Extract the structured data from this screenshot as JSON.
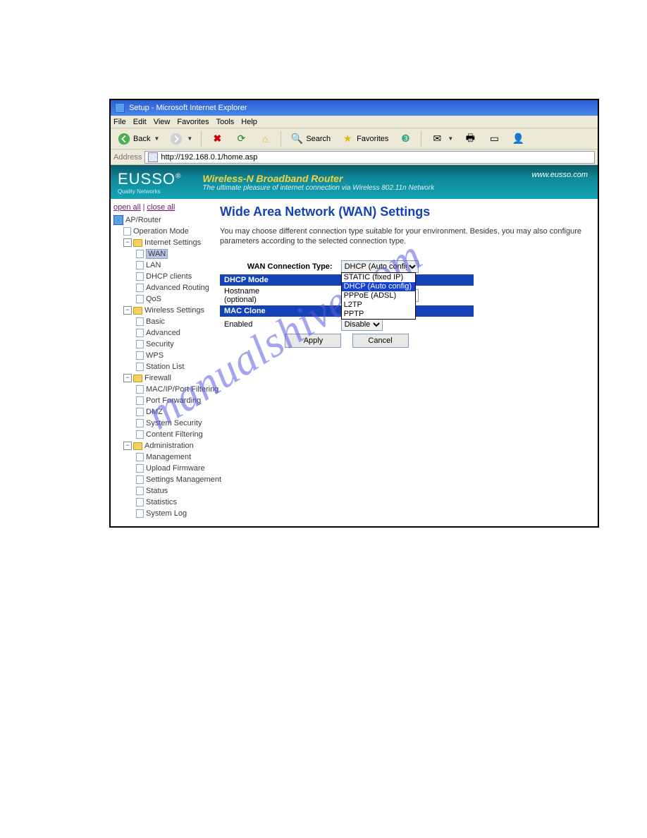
{
  "window": {
    "title": "Setup - Microsoft Internet Explorer"
  },
  "menubar": [
    "File",
    "Edit",
    "View",
    "Favorites",
    "Tools",
    "Help"
  ],
  "toolbar": {
    "back": "Back",
    "search": "Search",
    "favorites": "Favorites"
  },
  "address": {
    "label": "Address",
    "url": "http://192.168.0.1/home.asp"
  },
  "banner": {
    "logo": "EUSSO",
    "logo_sub": "Quality Networks",
    "title": "Wireless-N Broadband Router",
    "subtitle": "The ultimate pleasure of internet connection via Wireless 802.11n Network",
    "url": "www.eusso.com"
  },
  "sidebar": {
    "open_all": "open all",
    "close_all": "close all",
    "root": "AP/Router",
    "op_mode": "Operation Mode",
    "internet": "Internet Settings",
    "internet_items": [
      "WAN",
      "LAN",
      "DHCP clients",
      "Advanced Routing",
      "QoS"
    ],
    "wireless": "Wireless Settings",
    "wireless_items": [
      "Basic",
      "Advanced",
      "Security",
      "WPS",
      "Station List"
    ],
    "firewall": "Firewall",
    "firewall_items": [
      "MAC/IP/Port Filtering",
      "Port Forwarding",
      "DMZ",
      "System Security",
      "Content Filtering"
    ],
    "admin": "Administration",
    "admin_items": [
      "Management",
      "Upload Firmware",
      "Settings Management",
      "Status",
      "Statistics",
      "System Log"
    ]
  },
  "page": {
    "heading": "Wide Area Network (WAN) Settings",
    "desc": "You may choose different connection type suitable for your environment. Besides, you may also configure parameters according to the selected connection type.",
    "wan_type_label": "WAN Connection Type:",
    "wan_type_value": "DHCP (Auto config)",
    "wan_options": [
      "STATIC (fixed IP)",
      "DHCP (Auto config)",
      "PPPoE (ADSL)",
      "L2TP",
      "PPTP"
    ],
    "dhcp_mode": "DHCP Mode",
    "hostname": "Hostname",
    "hostname_sub": "(optional)",
    "hostname_value": "",
    "mac_clone": "MAC Clone",
    "enabled": "Enabled",
    "enabled_value": "Disable",
    "apply": "Apply",
    "cancel": "Cancel"
  },
  "watermark": "manualshive.com"
}
